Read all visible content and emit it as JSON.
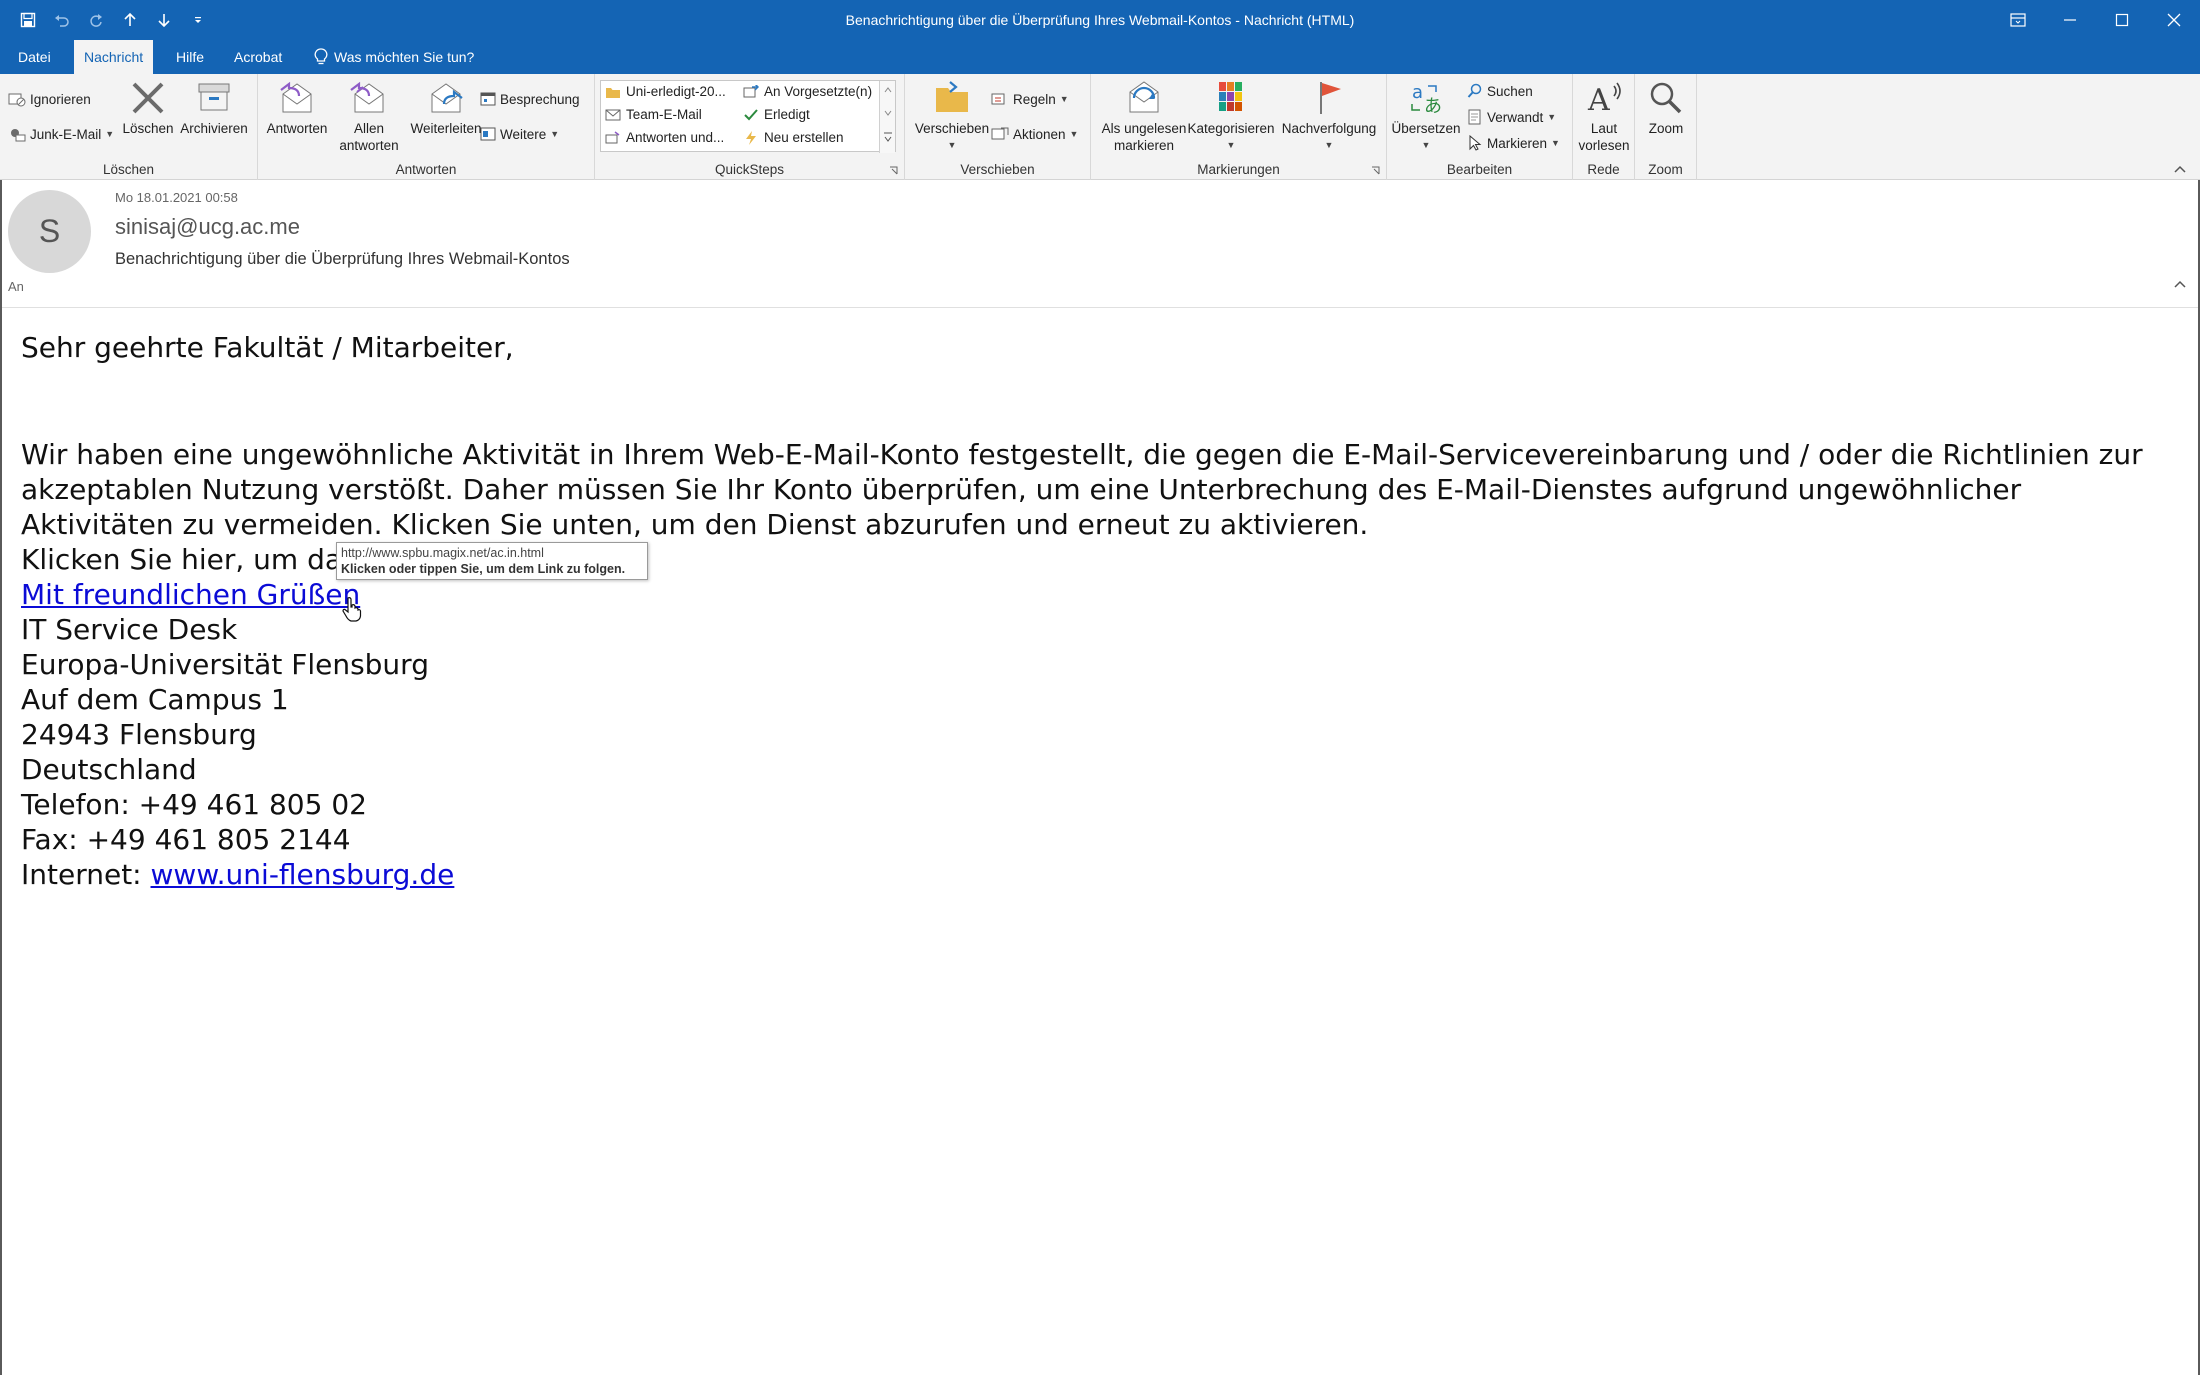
{
  "window": {
    "title": "Benachrichtigung über die Überprüfung Ihres Webmail-Kontos  -  Nachricht (HTML)",
    "qat_icons": [
      "save-icon",
      "undo-icon",
      "redo-icon",
      "up-arrow-icon",
      "down-arrow-icon",
      "customize-icon"
    ],
    "control_icons": [
      "ribbon-display-icon",
      "minimize-icon",
      "maximize-icon",
      "close-icon"
    ]
  },
  "tabs": {
    "datei": "Datei",
    "nachricht": "Nachricht",
    "hilfe": "Hilfe",
    "acrobat": "Acrobat",
    "tell_me": "Was möchten Sie tun?"
  },
  "ribbon": {
    "loeschen": {
      "label": "Löschen",
      "ignorieren": "Ignorieren",
      "junk": "Junk-E-Mail",
      "loeschen_btn": "Löschen",
      "archivieren": "Archivieren"
    },
    "antworten": {
      "label": "Antworten",
      "antworten_btn": "Antworten",
      "allen_1": "Allen",
      "allen_2": "antworten",
      "weiterleiten": "Weiterleiten",
      "besprechung": "Besprechung",
      "weitere": "Weitere"
    },
    "quicksteps": {
      "label": "QuickSteps",
      "items": [
        "Uni-erledigt-20...",
        "Team-E-Mail",
        "Antworten und...",
        "An Vorgesetzte(n)",
        "Erledigt",
        "Neu erstellen"
      ]
    },
    "verschieben": {
      "label": "Verschieben",
      "verschieben_btn": "Verschieben",
      "regeln": "Regeln",
      "aktionen": "Aktionen"
    },
    "markierungen": {
      "label": "Markierungen",
      "ungelesen_1": "Als ungelesen",
      "ungelesen_2": "markieren",
      "kategorisieren": "Kategorisieren",
      "nachverfolgung": "Nachverfolgung"
    },
    "bearbeiten": {
      "label": "Bearbeiten",
      "uebersetzen": "Übersetzen",
      "suchen": "Suchen",
      "verwandt": "Verwandt",
      "markieren": "Markieren"
    },
    "rede": {
      "label": "Rede",
      "laut_1": "Laut",
      "laut_2": "vorlesen"
    },
    "zoom": {
      "label": "Zoom",
      "zoom_btn": "Zoom"
    }
  },
  "message": {
    "avatar_initial": "S",
    "date": "Mo 18.01.2021 00:58",
    "sender": "sinisaj@ucg.ac.me",
    "subject": "Benachrichtigung über die Überprüfung Ihres Webmail-Kontos",
    "to_label": "An"
  },
  "body": {
    "greeting": "Sehr geehrte Fakultät / Mitarbeiter,",
    "para_line1": "Wir haben eine ungewöhnliche Aktivität in Ihrem Web-E-Mail-Konto festgestellt, die gegen die E-Mail-Servicevereinbarung und / oder die Richtlinien zur",
    "para_line2": "akzeptablen Nutzung verstößt. Daher müssen Sie Ihr Konto überprüfen, um eine Unterbrechung des E-Mail-Dienstes aufgrund ungewöhnlicher",
    "para_line3": "Aktivitäten zu vermeiden. Klicken Sie unten, um den Dienst abzurufen und erneut zu aktivieren.",
    "click_here": "Klicken Sie hier, um da",
    "greeting_link": "Mit freundlichen Grüßen",
    "sig": [
      "IT Service Desk",
      "Europa-Universität Flensburg",
      "Auf dem Campus 1",
      "24943 Flensburg",
      "Deutschland",
      "Telefon: +49 461 805 02",
      "Fax: +49 461 805 2144"
    ],
    "internet_label": "Internet: ",
    "internet_link": "www.uni-flensburg.de"
  },
  "tooltip": {
    "url": "http://www.spbu.magix.net/ac.in.html",
    "hint": "Klicken oder tippen Sie, um dem Link zu folgen."
  }
}
